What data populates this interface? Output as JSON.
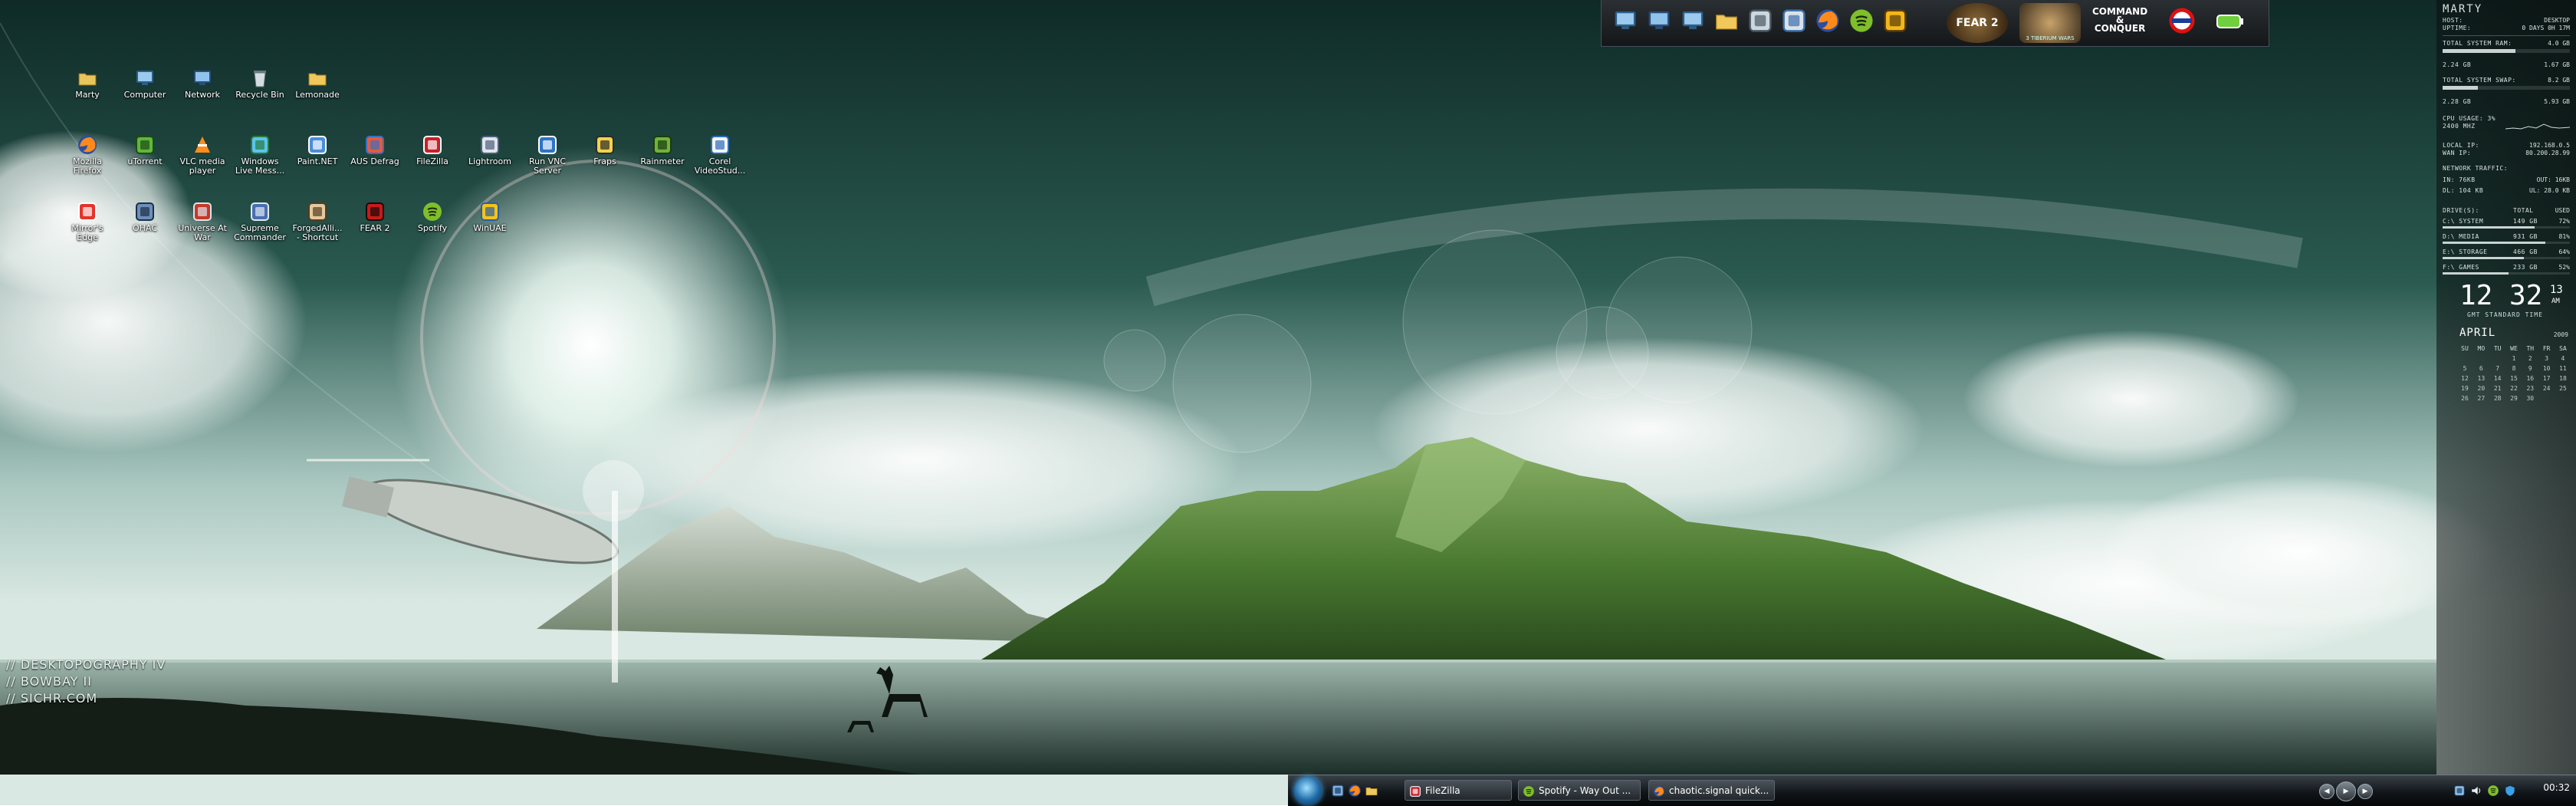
{
  "desktop": {
    "icons": [
      {
        "label": "Marty",
        "icon": "user-folder-icon"
      },
      {
        "label": "Computer",
        "icon": "computer-icon"
      },
      {
        "label": "Network",
        "icon": "network-icon"
      },
      {
        "label": "Recycle Bin",
        "icon": "recycle-bin-icon"
      },
      {
        "label": "Lemonade",
        "icon": "folder-icon"
      },
      {
        "label": "Mozilla Firefox",
        "icon": "firefox-icon"
      },
      {
        "label": "uTorrent",
        "icon": "utorrent-icon"
      },
      {
        "label": "VLC media player",
        "icon": "vlc-icon"
      },
      {
        "label": "Windows Live Mess...",
        "icon": "messenger-icon"
      },
      {
        "label": "Paint.NET",
        "icon": "paintnet-icon"
      },
      {
        "label": "AUS Defrag",
        "icon": "defrag-icon"
      },
      {
        "label": "FileZilla",
        "icon": "filezilla-icon"
      },
      {
        "label": "Lightroom",
        "icon": "lightroom-icon"
      },
      {
        "label": "Run VNC Server",
        "icon": "vnc-icon"
      },
      {
        "label": "Fraps",
        "icon": "fraps-icon"
      },
      {
        "label": "Rainmeter",
        "icon": "rainmeter-icon"
      },
      {
        "label": "Corel VideoStud...",
        "icon": "corel-icon"
      },
      {
        "label": "Mirror's Edge",
        "icon": "mirrors-edge-icon"
      },
      {
        "label": "OHAC",
        "icon": "ohac-icon"
      },
      {
        "label": "Universe At War",
        "icon": "universe-at-war-icon"
      },
      {
        "label": "Supreme Commander",
        "icon": "supreme-commander-icon"
      },
      {
        "label": "ForgedAlli... - Shortcut",
        "icon": "forged-alliance-icon"
      },
      {
        "label": "FEAR 2",
        "icon": "fear2-icon"
      },
      {
        "label": "Spotify",
        "icon": "spotify-icon"
      },
      {
        "label": "WinUAE",
        "icon": "winuae-icon"
      }
    ],
    "credits": [
      "// DESKTOPOGRAPHY IV",
      "// BOWBAY II",
      "// SICHR.COM"
    ]
  },
  "dock": {
    "launchers": [
      "computer-icon",
      "network-icon",
      "monitor-icon",
      "folder-icon",
      "printer-icon",
      "tools-icon",
      "firefox-icon",
      "spotify-icon",
      "pen-icon"
    ],
    "fear_label": "FEAR 2",
    "cnc_label_top": "COMMAND",
    "cnc_label_mid": "&",
    "cnc_label_bottom": "CONQUER",
    "cnc_sub": "3 TIBERIUM WARS",
    "extra": [
      "opera-icon",
      "battery-icon"
    ]
  },
  "sysinfo": {
    "user": "MARTY",
    "host_label": "HOST:",
    "host_value": "DESKTOP",
    "uptime_label": "UPTIME:",
    "uptime_value": "0 DAYS 0H 17M",
    "ram_label": "TOTAL SYSTEM RAM:",
    "ram_value": "4.0 GB",
    "ram_used": "2.24 GB",
    "ram_free": "1.67 GB",
    "ram_fill": 0.57,
    "swap_label": "TOTAL SYSTEM SWAP:",
    "swap_value": "8.2 GB",
    "swap_used": "2.28 GB",
    "swap_free": "5.93 GB",
    "swap_fill": 0.28,
    "cpu_label": "CPU USAGE: 3%",
    "cpu_sub": "2400 MHZ",
    "local_ip_label": "LOCAL IP:",
    "local_ip": "192.168.0.5",
    "wan_ip_label": "WAN IP:",
    "wan_ip": "80.200.28.99",
    "traffic_label": "NETWORK TRAFFIC:",
    "in_label": "IN: 76KB",
    "out_label": "OUT: 16KB",
    "dl_label": "DL: 104 KB",
    "ul_label": "UL: 28.0 KB",
    "drives_header_left": "DRIVE(S):",
    "drives_header_mid": "TOTAL",
    "drives_header_right": "USED",
    "drives": [
      {
        "name": "C:\\ SYSTEM",
        "total": "149 GB",
        "used": "72%",
        "fill": 0.72
      },
      {
        "name": "D:\\ MEDIA",
        "total": "931 GB",
        "used": "81%",
        "fill": 0.81
      },
      {
        "name": "E:\\ STORAGE",
        "total": "466 GB",
        "used": "64%",
        "fill": 0.64
      },
      {
        "name": "F:\\ GAMES",
        "total": "233 GB",
        "used": "52%",
        "fill": 0.52
      }
    ]
  },
  "clock_widget": {
    "hours": "12",
    "minutes": "32",
    "seconds": "13",
    "ampm": "AM",
    "tz": "GMT STANDARD TIME"
  },
  "calendar": {
    "month": "APRIL",
    "year": "2009",
    "days": [
      "SU",
      "MO",
      "TU",
      "WE",
      "TH",
      "FR",
      "SA"
    ],
    "weeks": [
      [
        "",
        "",
        "",
        "1",
        "2",
        "3",
        "4"
      ],
      [
        "5",
        "6",
        "7",
        "8",
        "9",
        "10",
        "11"
      ],
      [
        "12",
        "13",
        "14",
        "15",
        "16",
        "17",
        "18"
      ],
      [
        "19",
        "20",
        "21",
        "22",
        "23",
        "24",
        "25"
      ],
      [
        "26",
        "27",
        "28",
        "29",
        "30",
        "",
        ""
      ]
    ]
  },
  "taskbar": {
    "quicklaunch": [
      "show-desktop-icon",
      "firefox-icon",
      "folder-icon"
    ],
    "tasks": [
      {
        "label": "FileZilla",
        "icon": "filezilla-icon"
      },
      {
        "label": "Spotify - Way Out ...",
        "icon": "spotify-icon"
      },
      {
        "label": "chaotic.signal quick...",
        "icon": "firefox-icon"
      }
    ],
    "tray_icons": [
      "network-tray-icon",
      "volume-tray-icon",
      "spotify-tray-icon",
      "shield-tray-icon"
    ],
    "clock": "00:32"
  },
  "colors": {
    "accent": "#4bb4ff",
    "mountain": "#3f6b2a",
    "sky": "#254d47"
  }
}
